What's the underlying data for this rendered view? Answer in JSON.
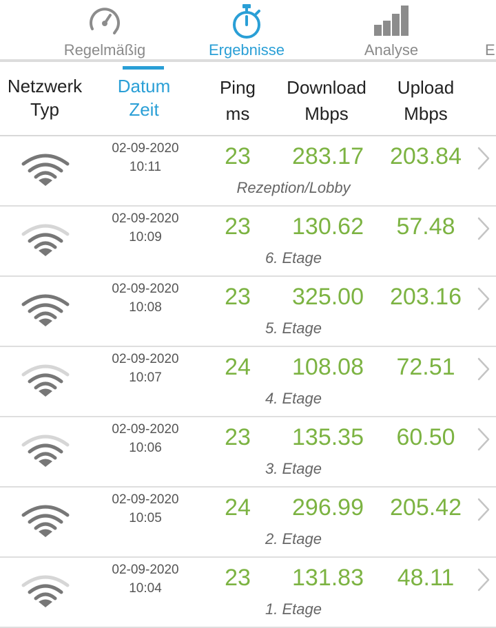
{
  "tabs": [
    {
      "label": "Regelmäßig",
      "icon": "speedometer-icon"
    },
    {
      "label": "Ergebnisse",
      "icon": "stopwatch-icon",
      "active": true
    },
    {
      "label": "Analyse",
      "icon": "bar-chart-icon"
    },
    {
      "label": "Ei"
    }
  ],
  "columns": {
    "netzwerk": {
      "line1": "Netzwerk",
      "line2": "Typ"
    },
    "datum": {
      "line1": "Datum",
      "line2": "Zeit"
    },
    "ping": {
      "line1": "Ping",
      "line2": "ms"
    },
    "download": {
      "line1": "Download",
      "line2": "Mbps"
    },
    "upload": {
      "line1": "Upload",
      "line2": "Mbps"
    }
  },
  "colors": {
    "accent": "#2a9fd6",
    "value": "#7cb342",
    "wifi_dark": "#777777",
    "wifi_light": "#d6d6d6"
  },
  "results": [
    {
      "date": "02-09-2020",
      "time": "10:11",
      "ping": "23",
      "download": "283.17",
      "upload": "203.84",
      "location": "Rezeption/Lobby",
      "wifi_signal": "full"
    },
    {
      "date": "02-09-2020",
      "time": "10:09",
      "ping": "23",
      "download": "130.62",
      "upload": "57.48",
      "location": "6. Etage",
      "wifi_signal": "partial"
    },
    {
      "date": "02-09-2020",
      "time": "10:08",
      "ping": "23",
      "download": "325.00",
      "upload": "203.16",
      "location": "5. Etage",
      "wifi_signal": "full"
    },
    {
      "date": "02-09-2020",
      "time": "10:07",
      "ping": "24",
      "download": "108.08",
      "upload": "72.51",
      "location": "4. Etage",
      "wifi_signal": "partial"
    },
    {
      "date": "02-09-2020",
      "time": "10:06",
      "ping": "23",
      "download": "135.35",
      "upload": "60.50",
      "location": "3. Etage",
      "wifi_signal": "partial"
    },
    {
      "date": "02-09-2020",
      "time": "10:05",
      "ping": "24",
      "download": "296.99",
      "upload": "205.42",
      "location": "2. Etage",
      "wifi_signal": "full"
    },
    {
      "date": "02-09-2020",
      "time": "10:04",
      "ping": "23",
      "download": "131.83",
      "upload": "48.11",
      "location": "1. Etage",
      "wifi_signal": "partial"
    }
  ]
}
